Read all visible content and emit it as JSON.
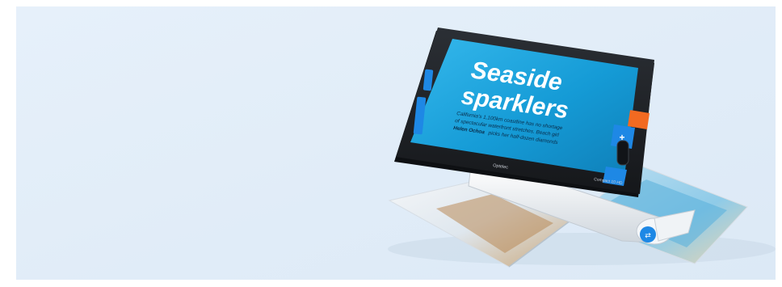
{
  "product": {
    "screen": {
      "headline_line1": "Seaside",
      "headline_line2": "sparklers",
      "body_line1": "California's 1,100km coastline has no shortage",
      "body_line2": "of spectacular waterfront stretches. Beach girl",
      "body_bold": "Helen Ochoa",
      "body_line3_rest": "picks her half-dozen diamonds"
    },
    "brand_left": "Optelec",
    "brand_right": "Compact 10 HD"
  },
  "colors": {
    "background": "#e3eef9",
    "device_frame": "#1f2227",
    "screen_blue": "#1aa3dd",
    "accent_orange": "#f26a21",
    "button_blue": "#1e88e5"
  }
}
